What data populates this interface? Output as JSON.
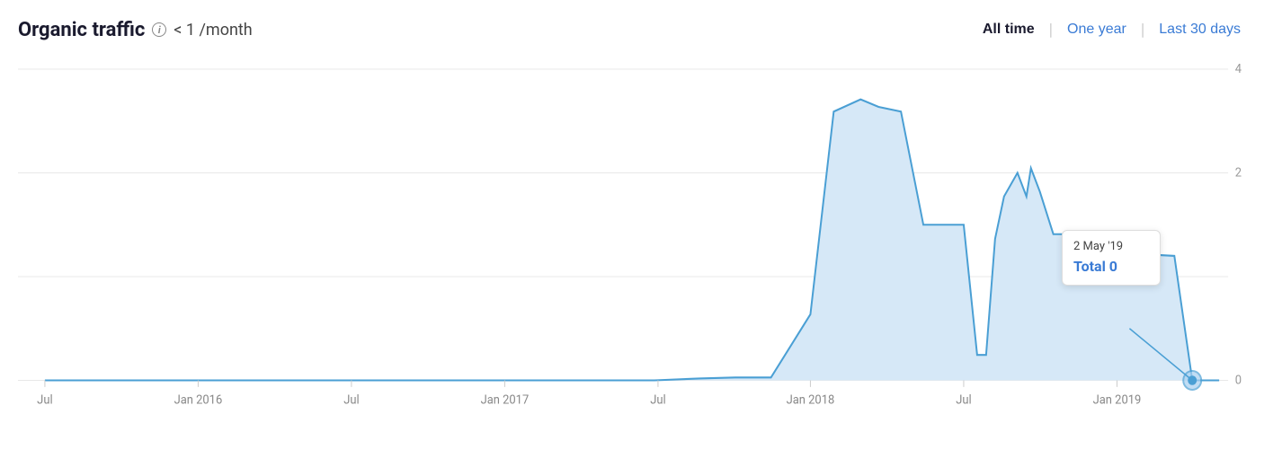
{
  "header": {
    "title": "Organic traffic",
    "info_icon": "i",
    "subtitle": "< 1 /month"
  },
  "time_filters": [
    {
      "label": "All time",
      "active": true
    },
    {
      "label": "One year",
      "active": false
    },
    {
      "label": "Last 30 days",
      "active": false
    }
  ],
  "chart": {
    "y_axis_labels": [
      "4",
      "2",
      "0"
    ],
    "x_axis_labels": [
      "Jul",
      "Jan 2016",
      "Jul",
      "Jan 2017",
      "Jul",
      "Jan 2018",
      "Jul",
      "Jan 2019"
    ],
    "tooltip": {
      "date": "2 May '19",
      "label": "Total 0"
    }
  }
}
